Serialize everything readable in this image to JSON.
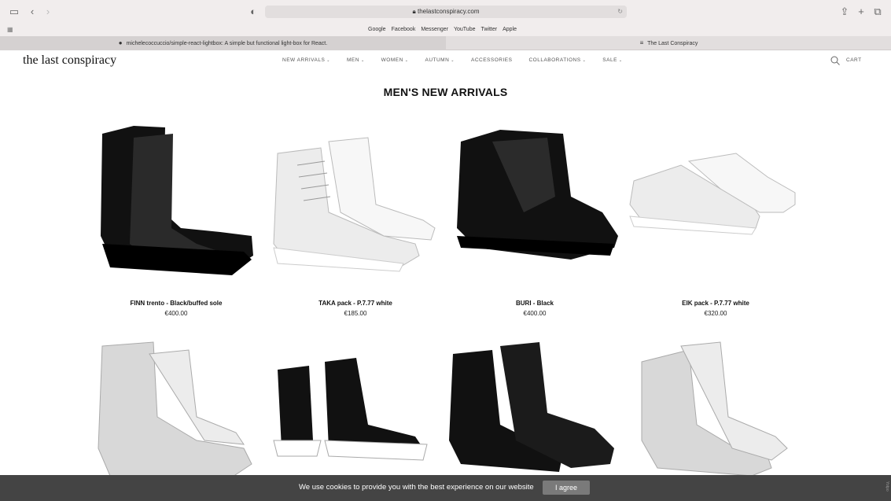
{
  "browser": {
    "url": "thelastconspiracy.com",
    "bookmarks": [
      "Google",
      "Facebook",
      "Messenger",
      "YouTube",
      "Twitter",
      "Apple"
    ],
    "tabs": [
      {
        "label": "michelecoccuccio/simple-react-lightbox: A simple but functional light-box for React.",
        "icon": "github-icon"
      },
      {
        "label": "The Last Conspiracy",
        "icon": "site-favicon"
      }
    ]
  },
  "site": {
    "logo": "the last conspiracy",
    "nav": [
      {
        "label": "NEW ARRIVALS",
        "caret": true
      },
      {
        "label": "MEN",
        "caret": true
      },
      {
        "label": "WOMEN",
        "caret": true
      },
      {
        "label": "AUTUMN",
        "caret": true
      },
      {
        "label": "ACCESSORIES",
        "caret": false
      },
      {
        "label": "COLLABORATIONS",
        "caret": true
      },
      {
        "label": "SALE",
        "caret": true
      }
    ],
    "cart_label": "CART"
  },
  "page_title": "MEN'S NEW ARRIVALS",
  "products": [
    {
      "name": "FINN trento - Black/buffed sole",
      "price": "€400.00",
      "shoe": "black-boot"
    },
    {
      "name": "TAKA pack - P.7.77 white",
      "price": "€185.00",
      "shoe": "white-hightop"
    },
    {
      "name": "BURI - Black",
      "price": "€400.00",
      "shoe": "black-laceup"
    },
    {
      "name": "EIK pack - P.7.77 white",
      "price": "€320.00",
      "shoe": "white-sneaker"
    },
    {
      "name": "",
      "price": "",
      "shoe": "white-boot"
    },
    {
      "name": "",
      "price": "",
      "shoe": "black-white-boot"
    },
    {
      "name": "",
      "price": "",
      "shoe": "black-chelsea"
    },
    {
      "name": "",
      "price": "",
      "shoe": "white-tall-boot"
    }
  ],
  "cookie": {
    "text": "We use cookies to provide you with the best experience on our website",
    "button": "I agree"
  },
  "side_badge": "Yotpo"
}
